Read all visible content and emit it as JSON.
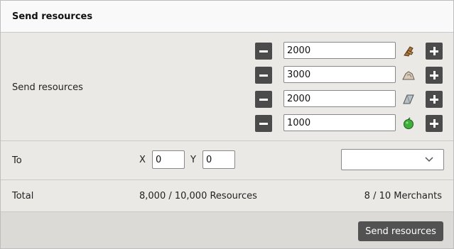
{
  "header": {
    "title": "Send resources"
  },
  "resources": {
    "label": "Send resources",
    "items": [
      {
        "icon": "wood-icon",
        "value": "2000"
      },
      {
        "icon": "clay-icon",
        "value": "3000"
      },
      {
        "icon": "iron-icon",
        "value": "2000"
      },
      {
        "icon": "crop-icon",
        "value": "1000"
      }
    ]
  },
  "destination": {
    "label": "To",
    "x_label": "X",
    "x_value": "0",
    "y_label": "Y",
    "y_value": "0",
    "village_select": ""
  },
  "total": {
    "label": "Total",
    "resources": "8,000 / 10,000 Resources",
    "merchants": "8 / 10 Merchants"
  },
  "footer": {
    "send_button": "Send resources"
  }
}
